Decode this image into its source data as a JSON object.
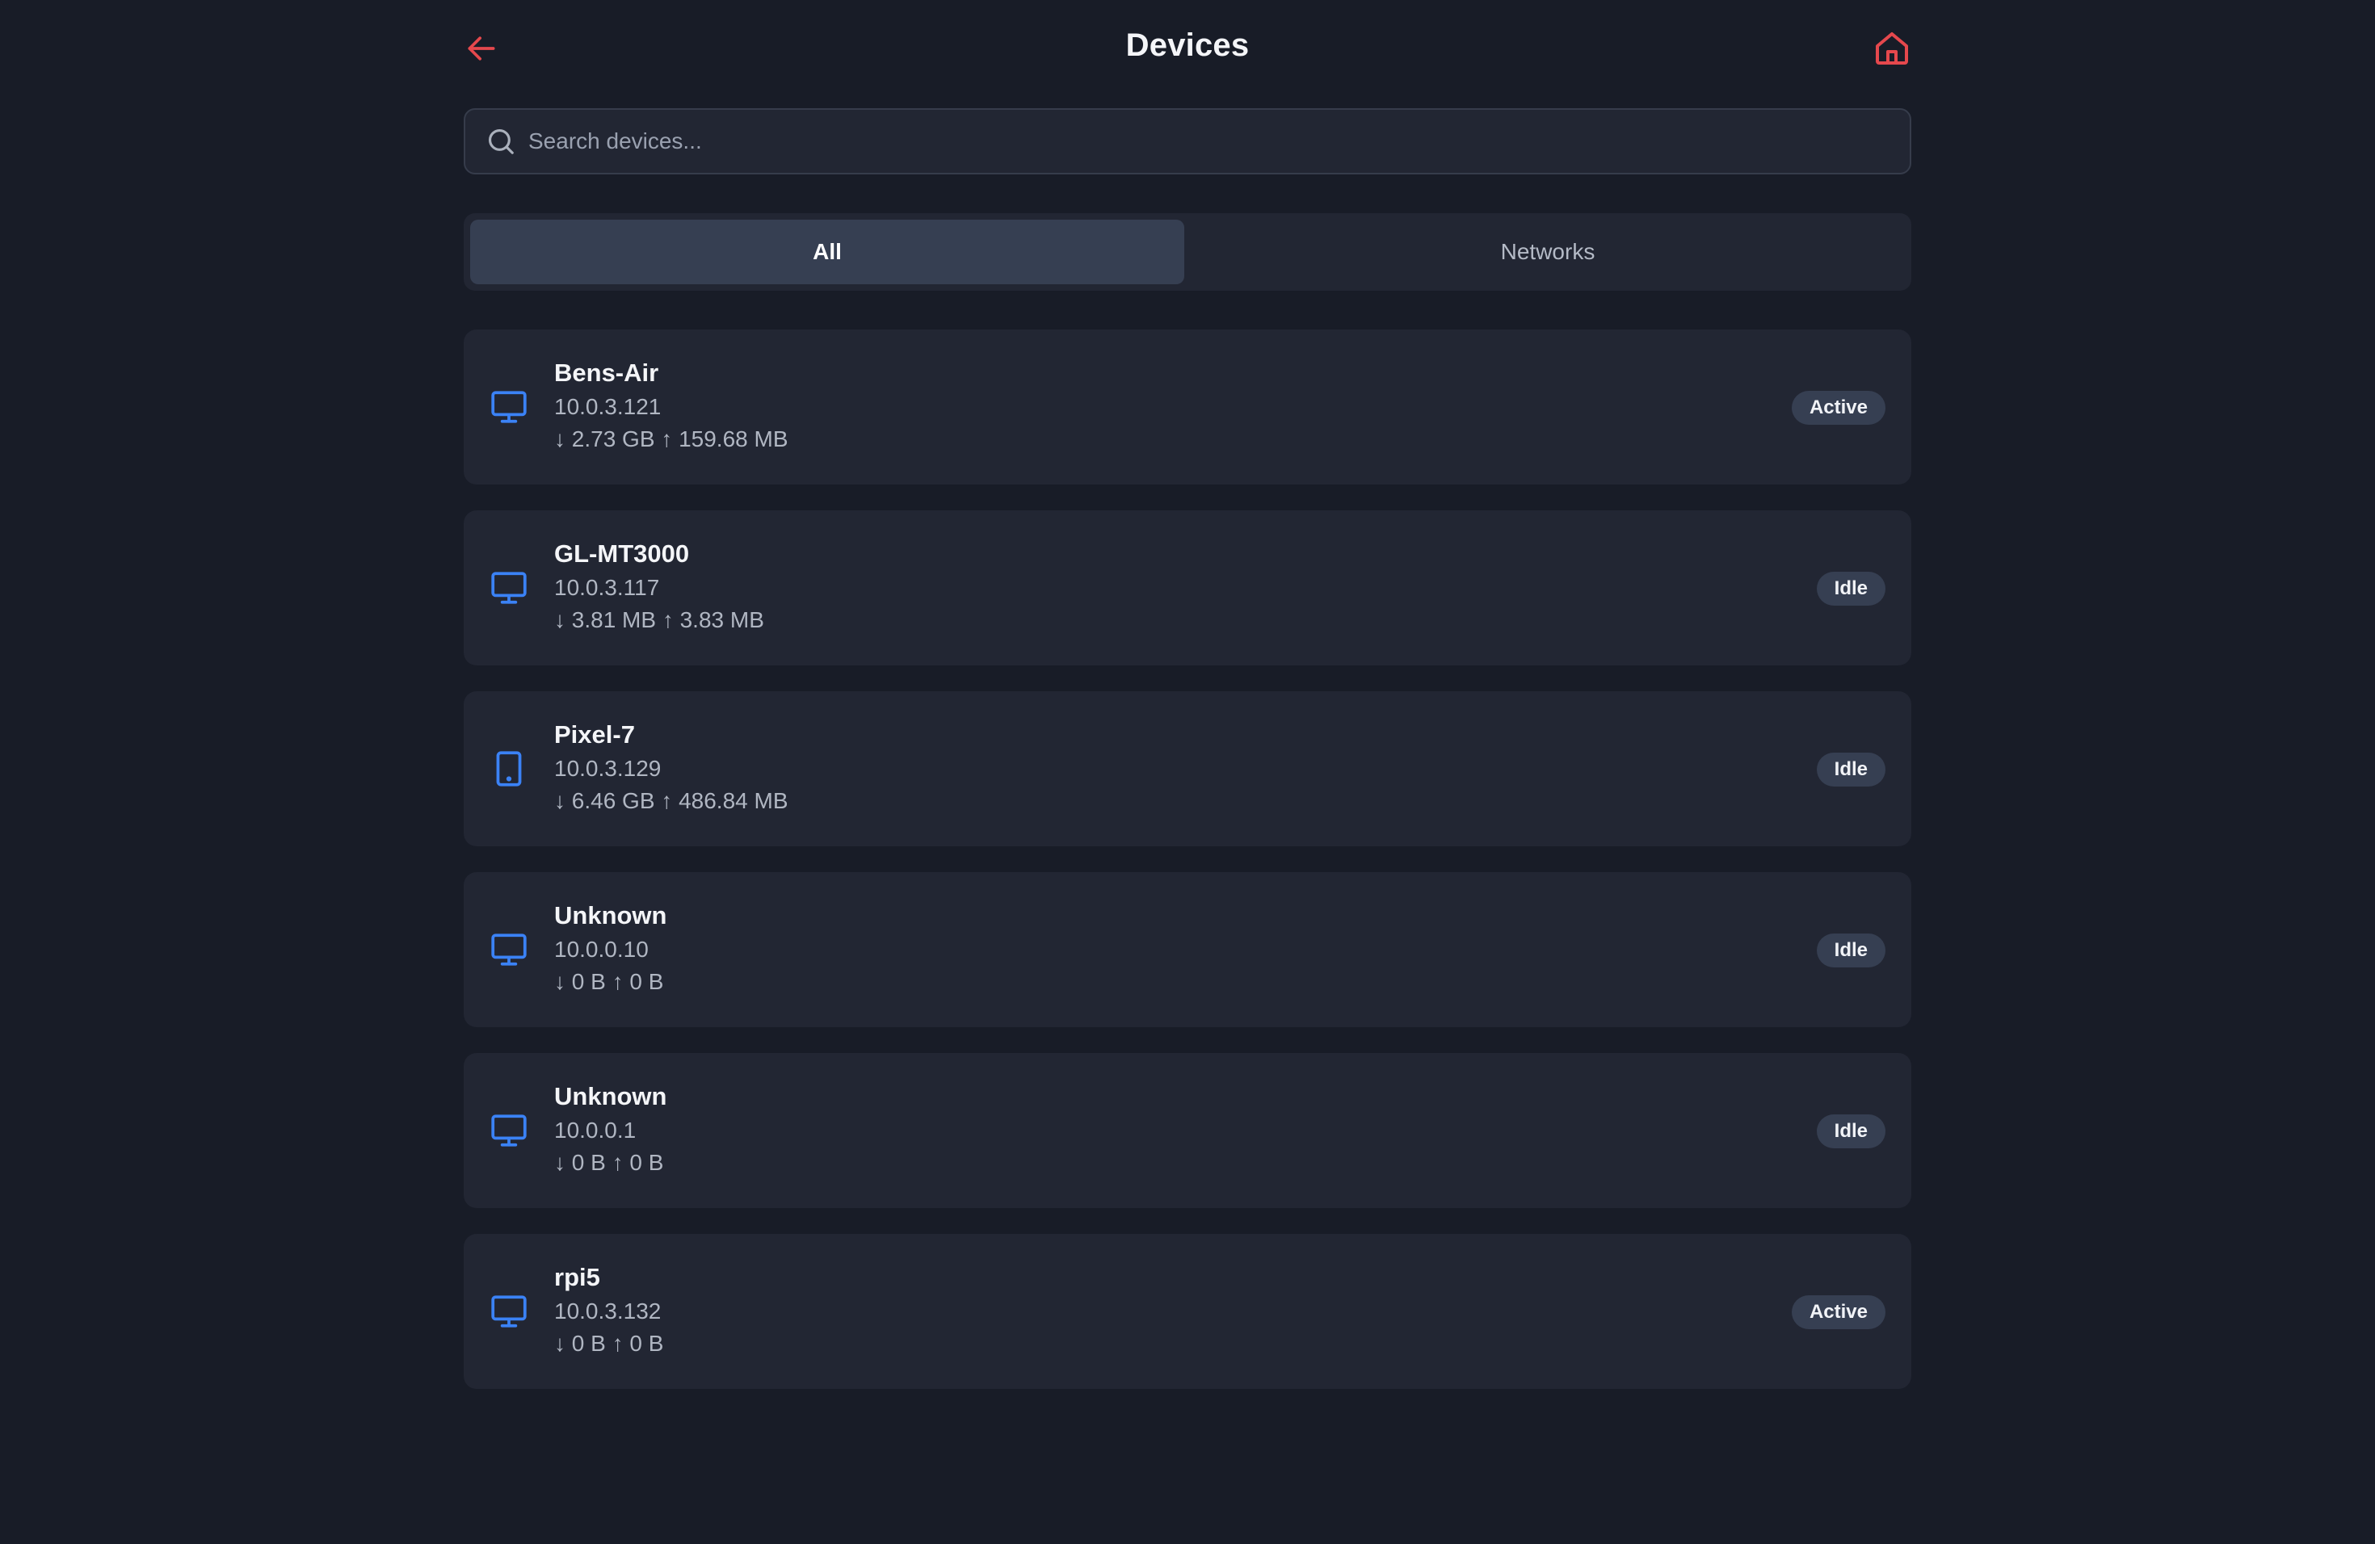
{
  "header": {
    "title": "Devices",
    "back_icon": "arrow-left-icon",
    "home_icon": "home-icon",
    "accent_color": "#e5484d"
  },
  "search": {
    "placeholder": "Search devices...",
    "value": ""
  },
  "tabs": [
    {
      "label": "All",
      "active": true
    },
    {
      "label": "Networks",
      "active": false
    }
  ],
  "devices": [
    {
      "name": "Bens-Air",
      "ip": "10.0.3.121",
      "traffic": "↓ 2.73 GB ↑ 159.68 MB",
      "status": "Active",
      "icon": "monitor-icon"
    },
    {
      "name": "GL-MT3000",
      "ip": "10.0.3.117",
      "traffic": "↓ 3.81 MB ↑ 3.83 MB",
      "status": "Idle",
      "icon": "monitor-icon"
    },
    {
      "name": "Pixel-7",
      "ip": "10.0.3.129",
      "traffic": "↓ 6.46 GB ↑ 486.84 MB",
      "status": "Idle",
      "icon": "tablet-icon"
    },
    {
      "name": "Unknown",
      "ip": "10.0.0.10",
      "traffic": "↓ 0 B ↑ 0 B",
      "status": "Idle",
      "icon": "monitor-icon"
    },
    {
      "name": "Unknown",
      "ip": "10.0.0.1",
      "traffic": "↓ 0 B ↑ 0 B",
      "status": "Idle",
      "icon": "monitor-icon"
    },
    {
      "name": "rpi5",
      "ip": "10.0.3.132",
      "traffic": "↓ 0 B ↑ 0 B",
      "status": "Active",
      "icon": "monitor-icon"
    }
  ],
  "colors": {
    "background": "#181c27",
    "card": "#222633",
    "badge": "#363f52",
    "device_icon": "#3b82f6"
  }
}
